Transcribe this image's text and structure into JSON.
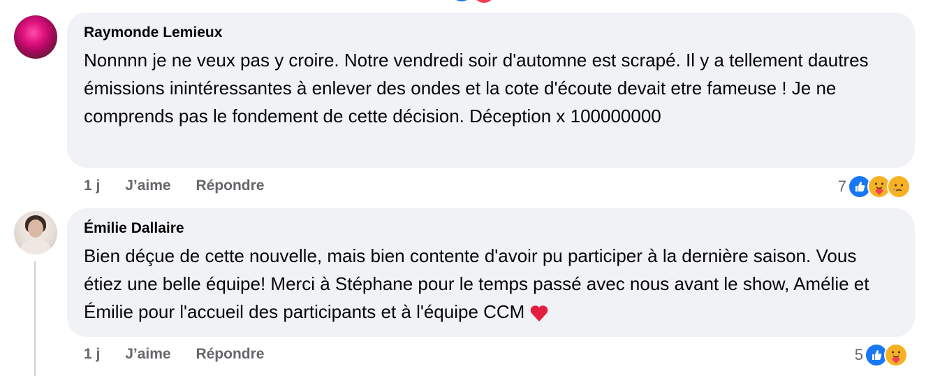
{
  "comments": [
    {
      "author": "Raymonde Lemieux",
      "text": "Nonnnn je ne veux pas y croire. Notre vendredi soir d'automne est scrapé. Il y a tellement dautres émissions inintéressantes à enlever des ondes et la cote d'écoute devait etre fameuse ! Je ne comprends pas le fondement de cette décision. Déception x 100000000",
      "time": "1 j",
      "like_label": "J’aime",
      "reply_label": "Répondre",
      "reaction_count": "7",
      "reactions": [
        "like-icon",
        "care-icon",
        "sad-icon"
      ]
    },
    {
      "author": "Émilie Dallaire",
      "text": "Bien déçue de cette nouvelle, mais bien contente d'avoir pu participer à la dernière saison. Vous étiez une belle équipe! Merci à Stéphane pour le temps passé avec nous avant le show, Amélie et Émilie pour l'accueil des participants et à l'équipe CCM",
      "text_emoji": "heart-icon",
      "time": "1 j",
      "like_label": "J’aime",
      "reply_label": "Répondre",
      "reaction_count": "5",
      "reactions": [
        "like-icon",
        "care-icon"
      ]
    }
  ],
  "colors": {
    "bubble": "#f0f2f5",
    "secondary_text": "#65676b",
    "like_blue": "#1877f2",
    "heart_red": "#e41e3f"
  }
}
